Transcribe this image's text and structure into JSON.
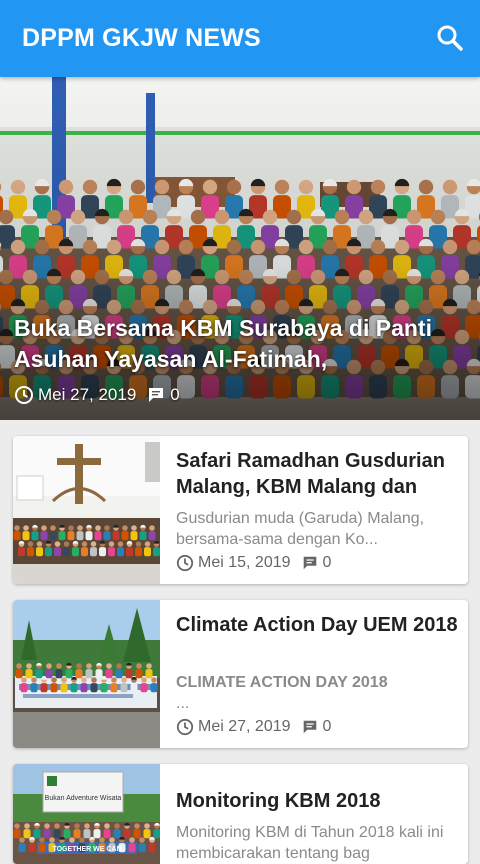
{
  "app": {
    "title": "DPPM GKJW NEWS",
    "search_icon": "search-icon",
    "bar_color": "#2196f3"
  },
  "featured": {
    "title": "Buka Bersama KBM Surabaya di Panti Asuhan Yayasan Al-Fatimah,",
    "date": "Mei 27, 2019",
    "comments": "0"
  },
  "articles": [
    {
      "title": "Safari Ramadhan Gusdurian Malang, KBM Malang dan",
      "excerpt": "Gusdurian muda (Garuda) Malang, bersama-sama dengan Ko...",
      "date": "Mei 15, 2019",
      "comments": "0"
    },
    {
      "title": "Climate Action Day UEM 2018",
      "excerpt": "CLIMATE ACTION DAY 2018",
      "excerpt_more": "...",
      "date": "Mei 27, 2019",
      "comments": "0"
    },
    {
      "title": "Monitoring KBM 2018",
      "excerpt": "Monitoring KBM di Tahun 2018 kali ini membicarakan tentang bag",
      "img_text": "Bukan Adventure Wisata",
      "img_text2": "TOGETHER WE CAN"
    }
  ]
}
